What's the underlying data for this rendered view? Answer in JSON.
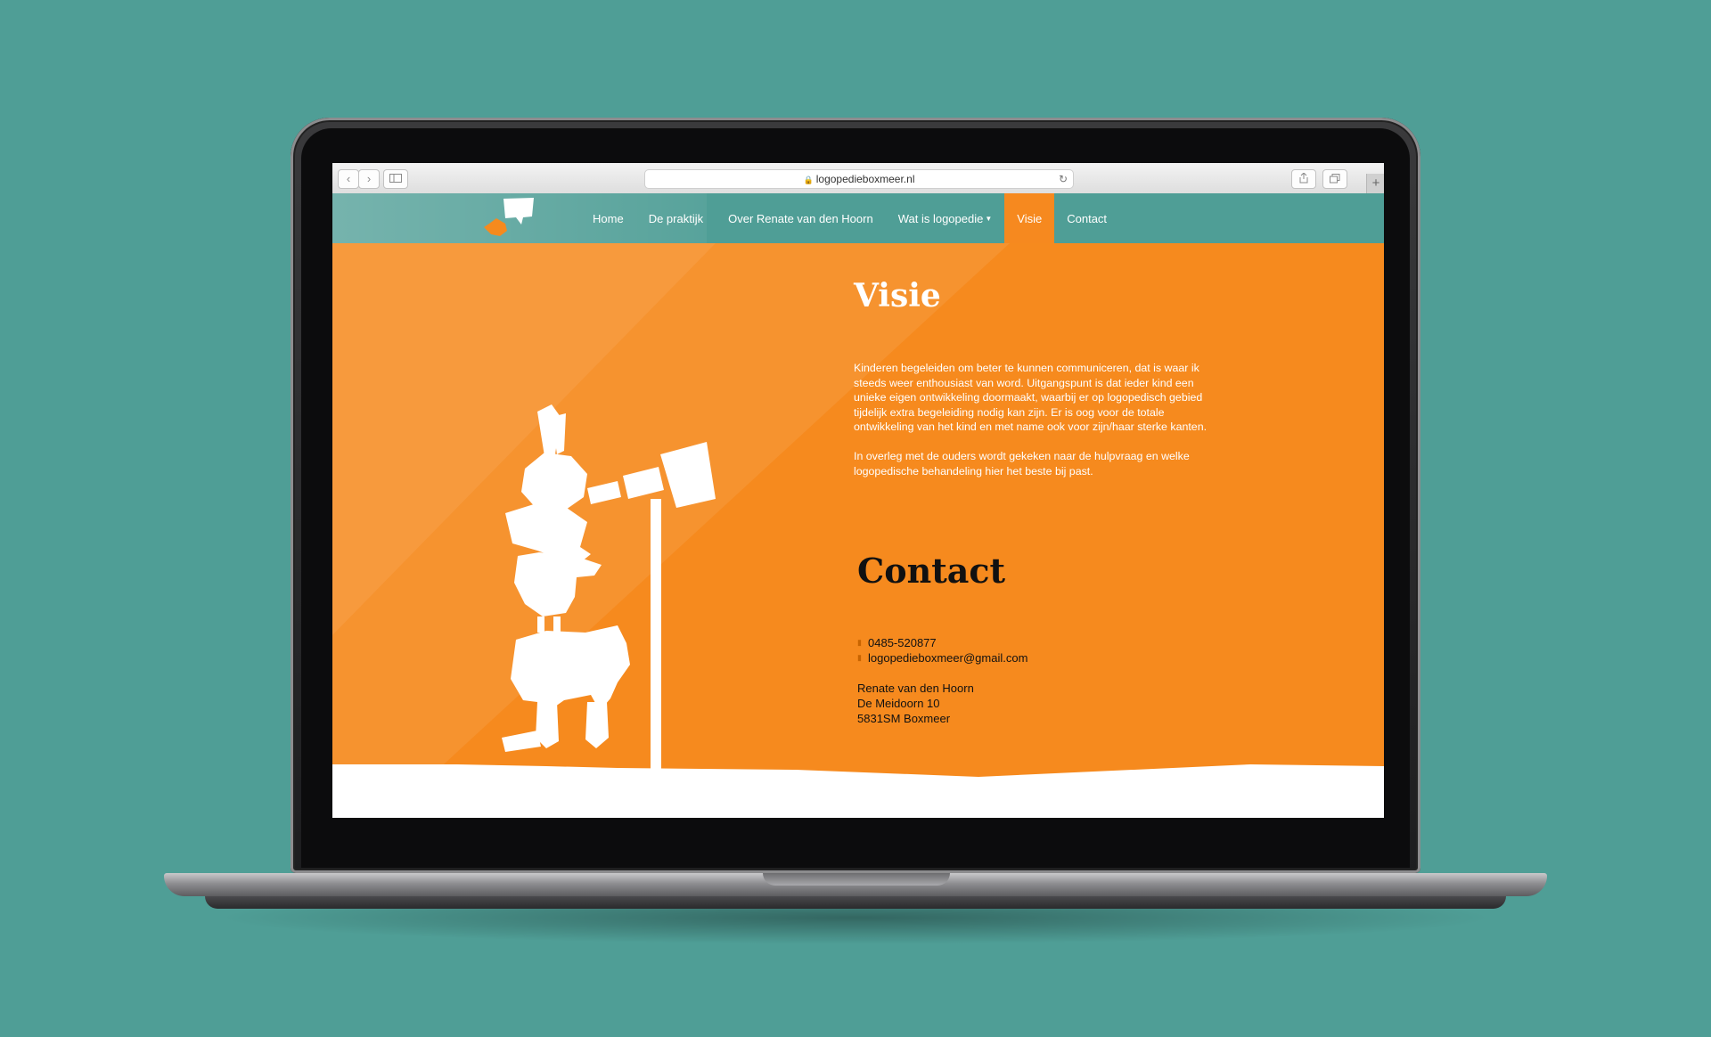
{
  "browser": {
    "url": "logopedieboxmeer.nl",
    "back_icon": "chevron-left-icon",
    "forward_icon": "chevron-right-icon",
    "sidebar_icon": "sidebar-icon",
    "reload_icon": "reload-icon",
    "share_icon": "share-icon",
    "tabs_icon": "tabs-icon",
    "new_tab_icon": "plus-icon"
  },
  "nav": {
    "logo_icon": "speech-bubble-bird-logo",
    "items": [
      {
        "label": "Home"
      },
      {
        "label": "De praktijk"
      },
      {
        "label": "Over Renate van den Hoorn"
      },
      {
        "label": "Wat is logopedie"
      },
      {
        "label": "Visie"
      },
      {
        "label": "Contact"
      }
    ],
    "active": "Visie"
  },
  "visie": {
    "title": "Visie",
    "paragraph1": "Kinderen begeleiden om beter te kunnen communiceren, dat is waar ik steeds weer enthousiast van word. Uitgangspunt is dat ieder kind een unieke eigen ontwikkeling doormaakt, waarbij er op logopedisch gebied tijdelijk extra begeleiding nodig kan zijn. Er is oog voor de totale ontwikkeling van het kind en met name ook voor zijn/haar sterke kanten.",
    "paragraph2": "In overleg met de ouders wordt gekeken naar de hulpvraag en welke logopedische behandeling hier het beste bij past."
  },
  "contact": {
    "title": "Contact",
    "phone": "0485-520877",
    "email": "logopedieboxmeer@gmail.com",
    "name": "Renate van den Hoorn",
    "street": "De Meidoorn 10",
    "city": "5831SM Boxmeer"
  },
  "colors": {
    "teal": "#4f9e96",
    "orange": "#f68a1e",
    "white": "#ffffff"
  }
}
